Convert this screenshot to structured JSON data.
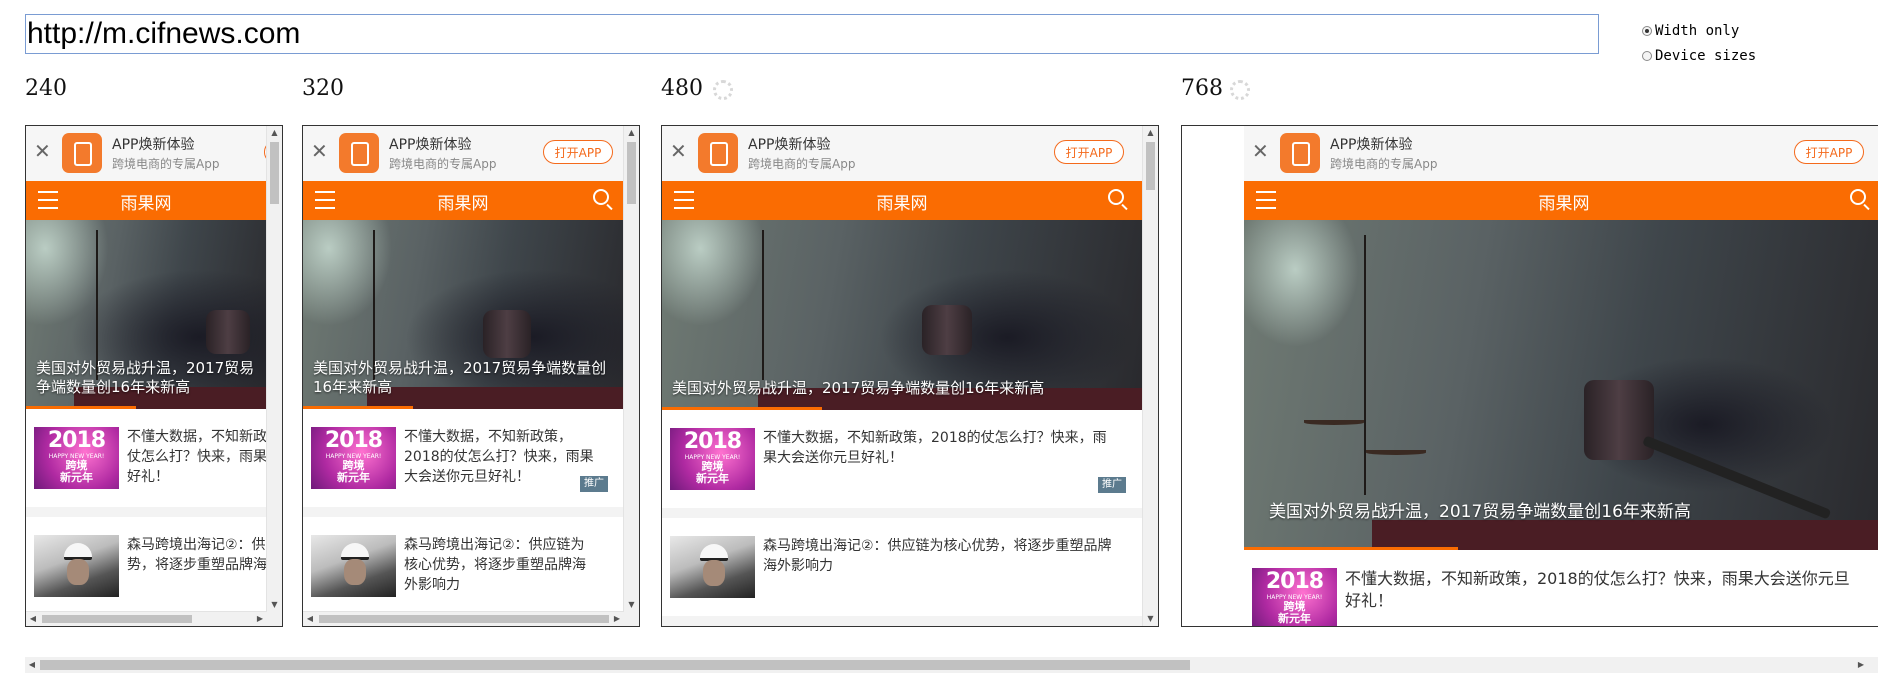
{
  "url_value": "http://m.cifnews.com",
  "options": {
    "width_only": "Width only",
    "device_sizes": "Device sizes",
    "selected": "width_only"
  },
  "frames": [
    {
      "size": "240",
      "loading": false
    },
    {
      "size": "320",
      "loading": false
    },
    {
      "size": "480",
      "loading": true
    },
    {
      "size": "768",
      "loading": true
    }
  ],
  "site": {
    "banner_title": "APP焕新体验",
    "banner_subtitle": "跨境电商的专属App",
    "open_app": "打开APP",
    "nav_title": "雨果网",
    "hero_caption": "美国对外贸易战升温，2017贸易争端数量创16年来新高",
    "article1": "不懂大数据，不知新政策，2018的仗怎么打？快来，雨果大会送你元旦好礼！",
    "article1_badge": "推广",
    "article2": "森马跨境出海记②：供应链为核心优势，将逐步重塑品牌海外影响力",
    "thumb_year": "2018",
    "thumb_hny": "HAPPY NEW YEAR!",
    "thumb_cn1": "跨境",
    "thumb_cn2": "新元年"
  },
  "colors": {
    "brand_orange": "#fa6c02",
    "badge": "#5c7b8e",
    "border": "#333333"
  },
  "icons": [
    "close-icon",
    "app-logo-icon",
    "menu-icon",
    "search-icon",
    "spinner-icon"
  ]
}
